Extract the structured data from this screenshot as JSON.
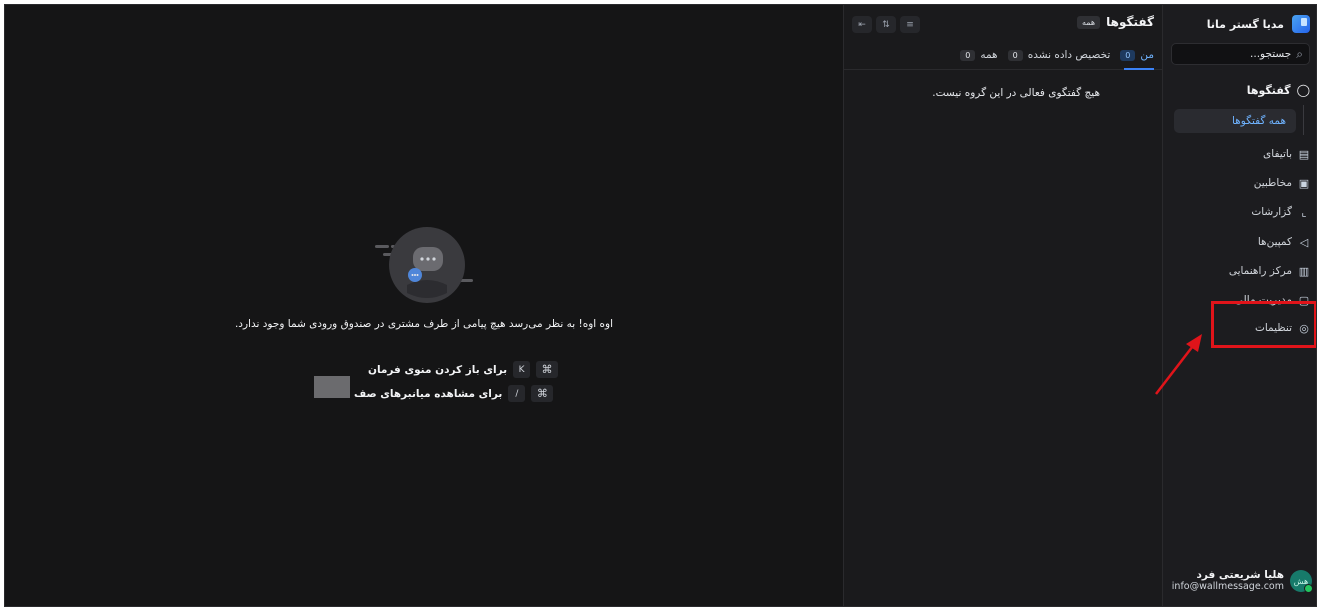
{
  "sidebar": {
    "brand": "مدیا گستر مانا",
    "search_placeholder": "جستجو...",
    "section_title": "گفتگوها",
    "active_item": "همه گفتگوها",
    "items": [
      {
        "label": "باتیفای",
        "icon": "inbox-icon"
      },
      {
        "label": "مخاطبین",
        "icon": "contacts-icon"
      },
      {
        "label": "گزارشات",
        "icon": "chart-icon"
      },
      {
        "label": "کمپین‌ها",
        "icon": "megaphone-icon"
      },
      {
        "label": "مرکز راهنمایی",
        "icon": "library-icon"
      },
      {
        "label": "مدیریت مالی",
        "icon": "wallet-icon"
      },
      {
        "label": "تنظیمات",
        "icon": "gear-icon"
      }
    ],
    "user": {
      "initials": "هش",
      "name": "هلیا شریعتی فرد",
      "email": "info@wallmessage.com"
    }
  },
  "conversations": {
    "title": "گفتگوها",
    "filter_chip": "همه",
    "tabs": [
      {
        "label": "من",
        "count": "0"
      },
      {
        "label": "تخصیص داده نشده",
        "count": "0"
      },
      {
        "label": "همه",
        "count": "0"
      }
    ],
    "empty_message": "هیچ گفتگوی فعالی در این گروه نیست."
  },
  "main": {
    "empty_title": "اوه اوه! به نظر می‌رسد هیچ پیامی از طرف مشتری در صندوق ورودی شما وجود ندارد.",
    "shortcuts": [
      {
        "key": "K",
        "label": "برای باز کردن منوی فرمان"
      },
      {
        "key": "/",
        "label": "برای مشاهده میانبرهای صف"
      }
    ],
    "cmd_symbol": "⌘"
  },
  "colors": {
    "accent": "#6fb3ff",
    "highlight": "#e0141a",
    "background": "#151516"
  }
}
